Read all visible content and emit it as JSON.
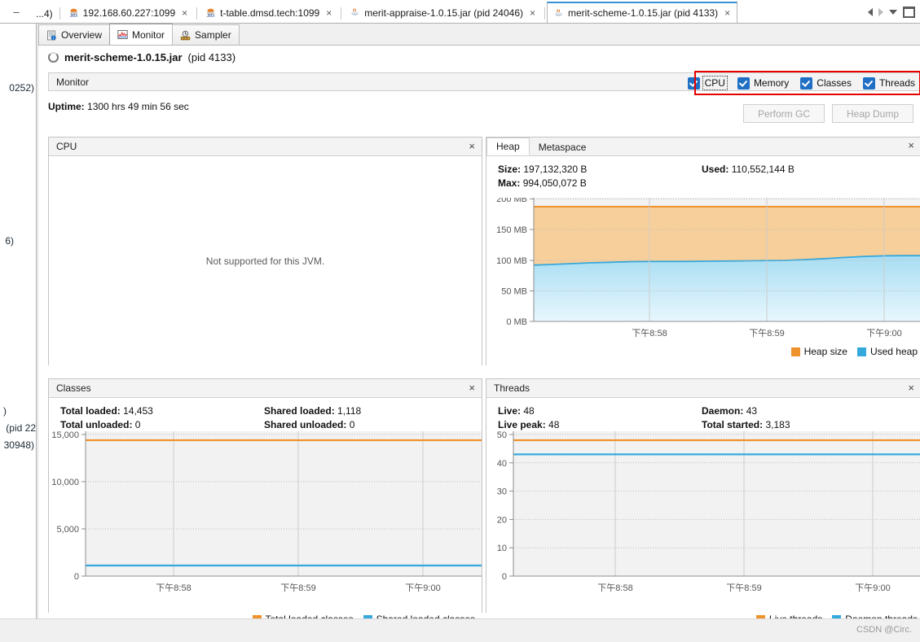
{
  "window": {
    "minimize_label": "–",
    "nav_prev_icon": "arrow-left-icon",
    "nav_next_icon": "arrow-right-icon",
    "nav_dropdown_icon": "chevron-down-icon",
    "restore_icon": "window-restore-icon"
  },
  "tabs": {
    "overflow_label": "...4)",
    "items": [
      {
        "label": "192.168.60.227:1099",
        "icon": "jmx-icon",
        "close": "×",
        "selected": false
      },
      {
        "label": "t-table.dmsd.tech:1099",
        "icon": "jmx-icon",
        "close": "×",
        "selected": false
      },
      {
        "label": "merit-appraise-1.0.15.jar (pid 24046)",
        "icon": "java-icon",
        "close": "×",
        "selected": false
      },
      {
        "label": "merit-scheme-1.0.15.jar (pid 4133)",
        "icon": "java-icon",
        "close": "×",
        "selected": true
      }
    ]
  },
  "sidebar": {
    "fragments": [
      {
        "text": "0252)",
        "top": 72,
        "right": 2
      },
      {
        "text": "6)",
        "top": 260,
        "right": 27
      },
      {
        "text": ")",
        "top": 469,
        "right": 36
      },
      {
        "text": "(pid 22",
        "top": 490,
        "right": 0
      },
      {
        "text": "30948)",
        "top": 511,
        "right": 2
      }
    ]
  },
  "view_tabs": [
    {
      "label": "Overview",
      "icon": "overview-icon",
      "selected": false
    },
    {
      "label": "Monitor",
      "icon": "monitor-chart-icon",
      "selected": true
    },
    {
      "label": "Sampler",
      "icon": "sampler-icon",
      "selected": false
    }
  ],
  "process": {
    "status_icon": "loading-spinner-icon",
    "name": "merit-scheme-1.0.15.jar",
    "pid": "(pid 4133)"
  },
  "monitor": {
    "band_label": "Monitor",
    "checkboxes": [
      {
        "label": "CPU",
        "checked": true,
        "focused": true
      },
      {
        "label": "Memory",
        "checked": true,
        "focused": false
      },
      {
        "label": "Classes",
        "checked": true,
        "focused": false
      },
      {
        "label": "Threads",
        "checked": true,
        "focused": false
      }
    ],
    "uptime_label": "Uptime:",
    "uptime_value": "1300 hrs 49 min 56 sec",
    "buttons": [
      {
        "label": "Perform GC",
        "enabled": false
      },
      {
        "label": "Heap Dump",
        "enabled": false
      }
    ]
  },
  "panels": {
    "cpu": {
      "title": "CPU",
      "close": "×",
      "message": "Not supported for this JVM."
    },
    "heap": {
      "tabs": [
        {
          "label": "Heap",
          "selected": true
        },
        {
          "label": "Metaspace",
          "selected": false
        }
      ],
      "close": "×",
      "stats": [
        {
          "label": "Size:",
          "value": "197,132,320 B"
        },
        {
          "label": "Used:",
          "value": "110,552,144 B"
        },
        {
          "label": "Max:",
          "value": "994,050,072 B"
        }
      ]
    },
    "classes": {
      "title": "Classes",
      "close": "×",
      "stats": [
        {
          "label": "Total loaded:",
          "value": "14,453"
        },
        {
          "label": "Shared loaded:",
          "value": "1,118"
        },
        {
          "label": "Total unloaded:",
          "value": "0"
        },
        {
          "label": "Shared unloaded:",
          "value": "0"
        }
      ]
    },
    "threads": {
      "title": "Threads",
      "close": "×",
      "stats": [
        {
          "label": "Live:",
          "value": "48"
        },
        {
          "label": "Daemon:",
          "value": "43"
        },
        {
          "label": "Live peak:",
          "value": "48"
        },
        {
          "label": "Total started:",
          "value": "3,183"
        }
      ]
    }
  },
  "colors": {
    "orange": "#f0922b",
    "orange_fill": "#f7cf9a",
    "blue": "#36a9dc",
    "blue_fill": "#bfe6f7",
    "accent_tab": "#3a93d6",
    "highlight_red": "#e60000"
  },
  "chart_data": [
    {
      "id": "heap-chart",
      "type": "area",
      "title": "Heap",
      "xlabel": "",
      "ylabel": "",
      "ylim": [
        0,
        205
      ],
      "yunit": "MB",
      "yticks": [
        0,
        50,
        100,
        150,
        200
      ],
      "ytick_labels": [
        "0 MB",
        "50 MB",
        "100 MB",
        "150 MB",
        "200 MB"
      ],
      "xtick_labels": [
        "下午8:58",
        "下午8:59",
        "下午9:00"
      ],
      "grid": true,
      "legend_position": "bottom-right",
      "series": [
        {
          "name": "Heap size",
          "color": "#f0922b",
          "fill": "#f7cf9a",
          "values": [
            188,
            188,
            188,
            188,
            188,
            188,
            188,
            188,
            188,
            188,
            188,
            188,
            188,
            188,
            188,
            188,
            188,
            188,
            188,
            188,
            188
          ]
        },
        {
          "name": "Used heap",
          "color": "#36a9dc",
          "fill": "#bfe6f7",
          "values": [
            92,
            93,
            94,
            95,
            95,
            96,
            97,
            97,
            97,
            97,
            97,
            98,
            98,
            98,
            98,
            99,
            100,
            101,
            103,
            104,
            104
          ]
        }
      ]
    },
    {
      "id": "classes-chart",
      "type": "line",
      "title": "Classes",
      "xlabel": "",
      "ylabel": "",
      "ylim": [
        0,
        15500
      ],
      "yticks": [
        0,
        5000,
        10000,
        15000
      ],
      "ytick_labels": [
        "0",
        "5,000",
        "10,000",
        "15,000"
      ],
      "xtick_labels": [
        "下午8:58",
        "下午8:59",
        "下午9:00"
      ],
      "grid": true,
      "legend_position": "bottom-right",
      "series": [
        {
          "name": "Total loaded classes",
          "color": "#f0922b",
          "values": [
            14453,
            14453,
            14453,
            14453,
            14453,
            14453,
            14453,
            14453,
            14453,
            14453,
            14453
          ]
        },
        {
          "name": "Shared loaded classes",
          "color": "#36a9dc",
          "values": [
            1118,
            1118,
            1118,
            1118,
            1118,
            1118,
            1118,
            1118,
            1118,
            1118,
            1118
          ]
        }
      ]
    },
    {
      "id": "threads-chart",
      "type": "line",
      "title": "Threads",
      "xlabel": "",
      "ylabel": "",
      "ylim": [
        0,
        51
      ],
      "yticks": [
        0,
        10,
        20,
        30,
        40,
        50
      ],
      "ytick_labels": [
        "0",
        "10",
        "20",
        "30",
        "40",
        "50"
      ],
      "xtick_labels": [
        "下午8:58",
        "下午8:59",
        "下午9:00"
      ],
      "grid": true,
      "legend_position": "bottom-right",
      "series": [
        {
          "name": "Live threads",
          "color": "#f0922b",
          "values": [
            48,
            48,
            48,
            48,
            48,
            48,
            48,
            48,
            48,
            48,
            48
          ]
        },
        {
          "name": "Daemon threads",
          "color": "#36a9dc",
          "values": [
            43,
            43,
            43,
            43,
            43,
            43,
            43,
            43,
            43,
            43,
            43
          ]
        }
      ]
    }
  ],
  "statusbar": {
    "credit": "CSDN @Circ."
  }
}
